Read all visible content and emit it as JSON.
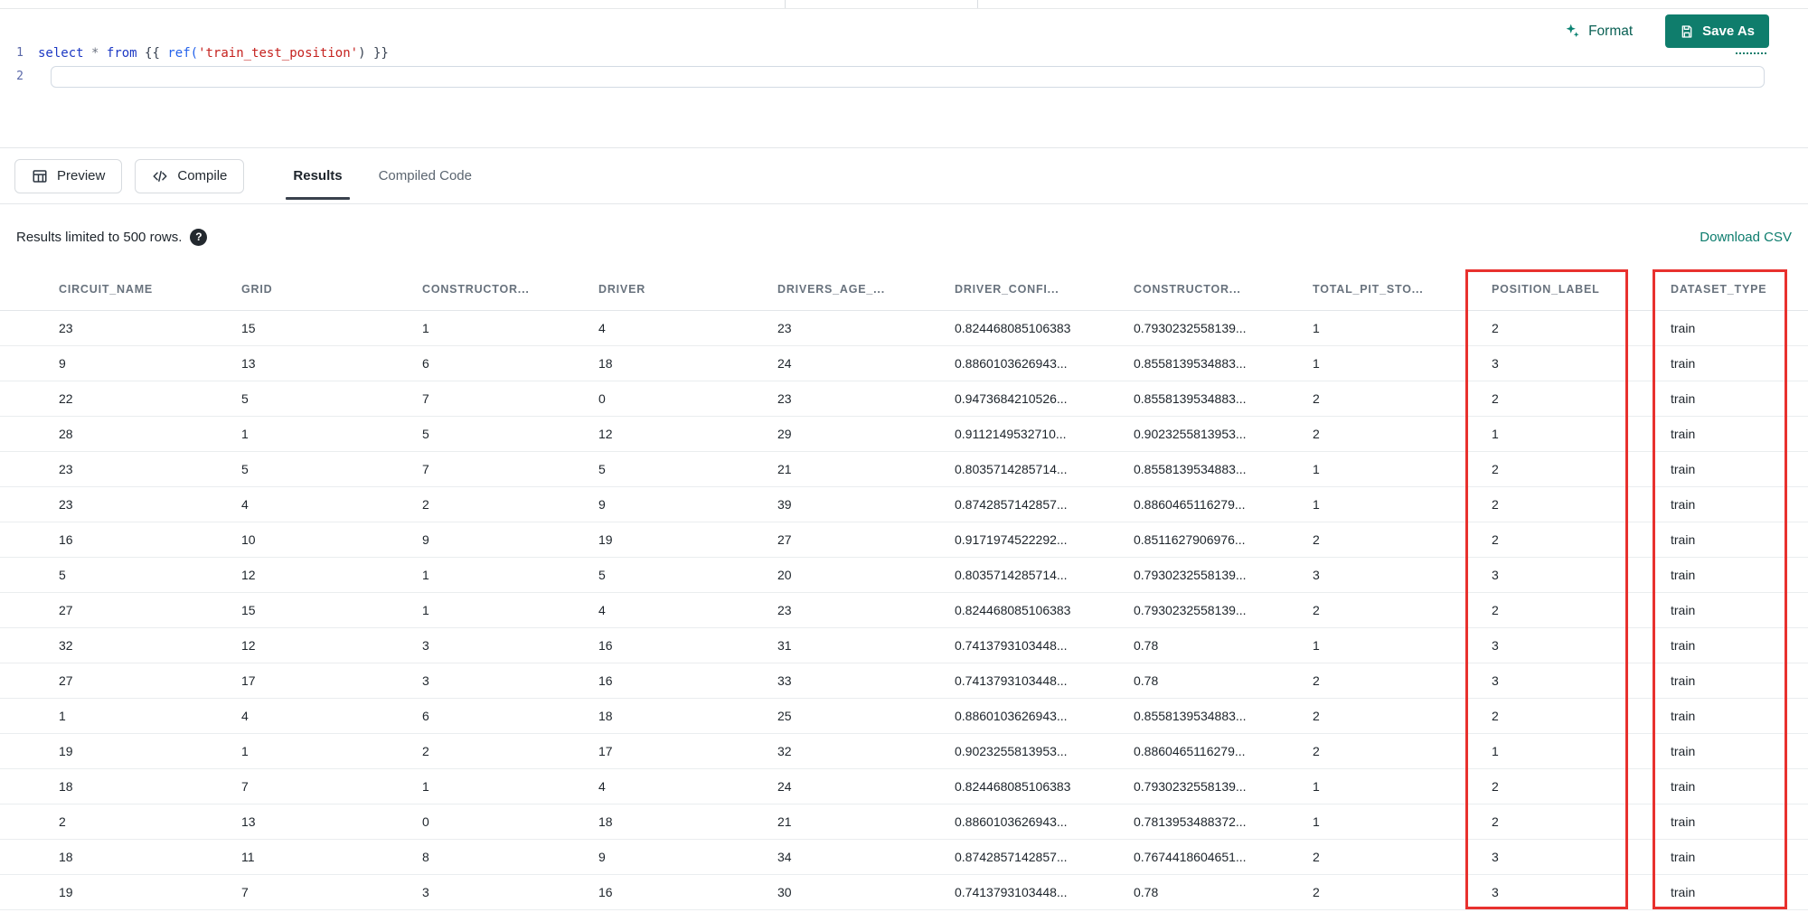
{
  "header": {
    "format_label": "Format",
    "save_as_label": "Save As"
  },
  "editor": {
    "lines": [
      {
        "number": "1"
      },
      {
        "number": "2"
      }
    ],
    "code": {
      "kw_select": "select",
      "op_star": "*",
      "kw_from": "from",
      "jinja_open": "{{",
      "fn_ref": "ref(",
      "str_ref": "'train_test_position'",
      "paren_close": ")",
      "jinja_close": "}}"
    }
  },
  "toolbar": {
    "preview_label": "Preview",
    "compile_label": "Compile",
    "tabs": [
      {
        "label": "Results",
        "active": true
      },
      {
        "label": "Compiled Code",
        "active": false
      }
    ]
  },
  "results_bar": {
    "limit_text": "Results limited to 500 rows.",
    "help_glyph": "?",
    "download_label": "Download CSV"
  },
  "table": {
    "columns": [
      "CIRCUIT_NAME",
      "GRID",
      "CONSTRUCTOR...",
      "DRIVER",
      "DRIVERS_AGE_...",
      "DRIVER_CONFI...",
      "CONSTRUCTOR...",
      "TOTAL_PIT_STO...",
      "POSITION_LABEL",
      "DATASET_TYPE"
    ],
    "highlighted_columns": [
      "POSITION_LABEL",
      "DATASET_TYPE"
    ],
    "rows": [
      [
        "23",
        "15",
        "1",
        "4",
        "23",
        "0.824468085106383",
        "0.7930232558139...",
        "1",
        "2",
        "train"
      ],
      [
        "9",
        "13",
        "6",
        "18",
        "24",
        "0.8860103626943...",
        "0.8558139534883...",
        "1",
        "3",
        "train"
      ],
      [
        "22",
        "5",
        "7",
        "0",
        "23",
        "0.9473684210526...",
        "0.8558139534883...",
        "2",
        "2",
        "train"
      ],
      [
        "28",
        "1",
        "5",
        "12",
        "29",
        "0.9112149532710...",
        "0.9023255813953...",
        "2",
        "1",
        "train"
      ],
      [
        "23",
        "5",
        "7",
        "5",
        "21",
        "0.8035714285714...",
        "0.8558139534883...",
        "1",
        "2",
        "train"
      ],
      [
        "23",
        "4",
        "2",
        "9",
        "39",
        "0.8742857142857...",
        "0.8860465116279...",
        "1",
        "2",
        "train"
      ],
      [
        "16",
        "10",
        "9",
        "19",
        "27",
        "0.9171974522292...",
        "0.8511627906976...",
        "2",
        "2",
        "train"
      ],
      [
        "5",
        "12",
        "1",
        "5",
        "20",
        "0.8035714285714...",
        "0.7930232558139...",
        "3",
        "3",
        "train"
      ],
      [
        "27",
        "15",
        "1",
        "4",
        "23",
        "0.824468085106383",
        "0.7930232558139...",
        "2",
        "2",
        "train"
      ],
      [
        "32",
        "12",
        "3",
        "16",
        "31",
        "0.7413793103448...",
        "0.78",
        "1",
        "3",
        "train"
      ],
      [
        "27",
        "17",
        "3",
        "16",
        "33",
        "0.7413793103448...",
        "0.78",
        "2",
        "3",
        "train"
      ],
      [
        "1",
        "4",
        "6",
        "18",
        "25",
        "0.8860103626943...",
        "0.8558139534883...",
        "2",
        "2",
        "train"
      ],
      [
        "19",
        "1",
        "2",
        "17",
        "32",
        "0.9023255813953...",
        "0.8860465116279...",
        "2",
        "1",
        "train"
      ],
      [
        "18",
        "7",
        "1",
        "4",
        "24",
        "0.824468085106383",
        "0.7930232558139...",
        "1",
        "2",
        "train"
      ],
      [
        "2",
        "13",
        "0",
        "18",
        "21",
        "0.8860103626943...",
        "0.7813953488372...",
        "1",
        "2",
        "train"
      ],
      [
        "18",
        "11",
        "8",
        "9",
        "34",
        "0.8742857142857...",
        "0.7674418604651...",
        "2",
        "3",
        "train"
      ],
      [
        "19",
        "7",
        "3",
        "16",
        "30",
        "0.7413793103448...",
        "0.78",
        "2",
        "3",
        "train"
      ]
    ]
  },
  "colors": {
    "accent_teal": "#0f7d6c",
    "link_teal": "#0c7c6d",
    "highlight_red": "#e8312e"
  }
}
